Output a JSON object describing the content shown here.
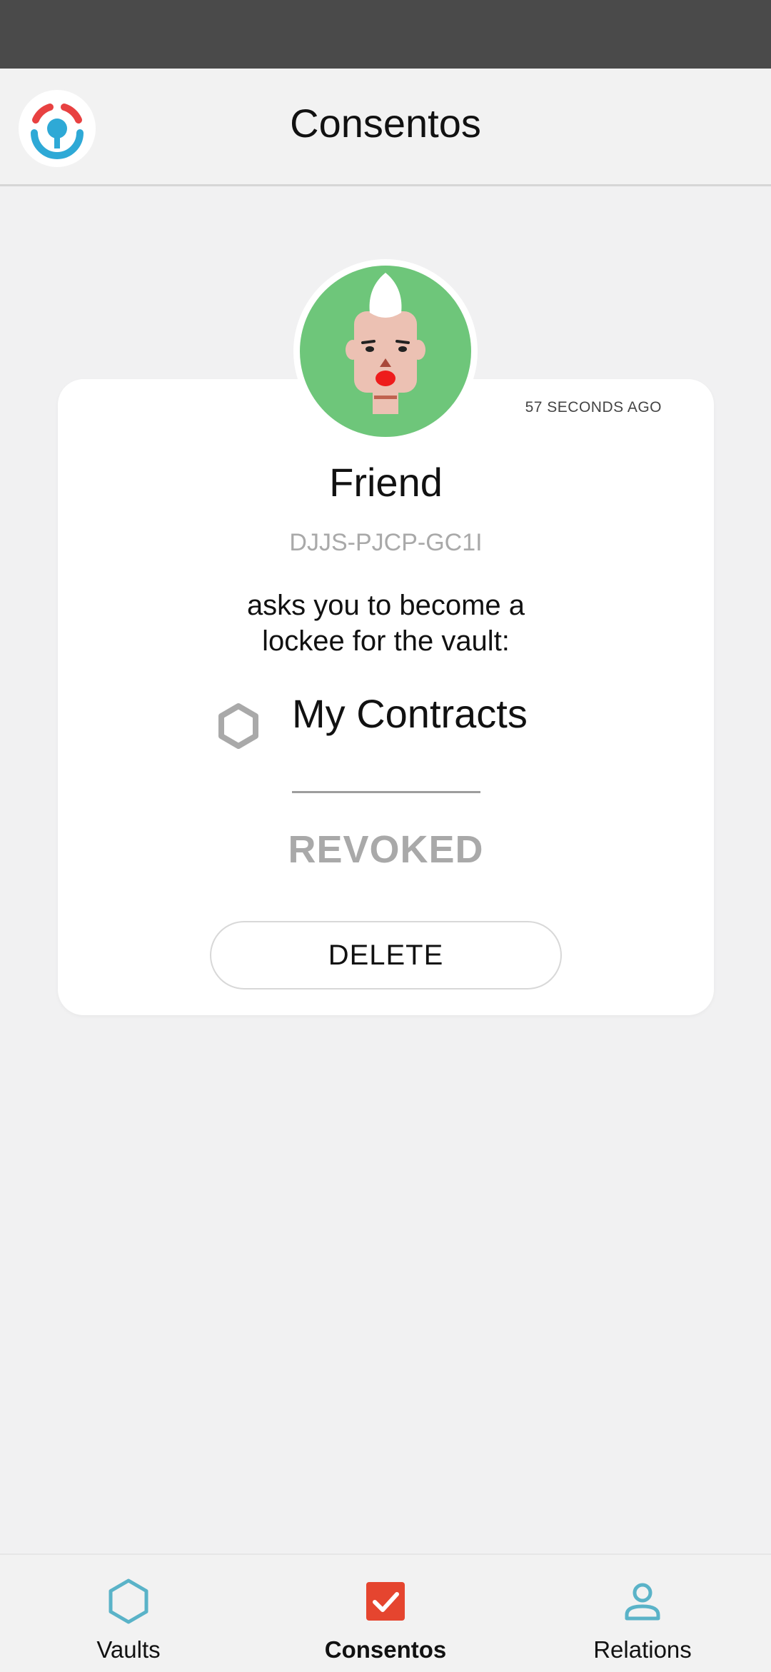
{
  "app_bar": {
    "title": "Consentos"
  },
  "card": {
    "timestamp": "57 SECONDS AGO",
    "friend_name": "Friend",
    "friend_code": "DJJS-PJCP-GC1I",
    "request_text": "asks you to become a\nlockee for the vault:",
    "vault_name": "My Contracts",
    "status": "REVOKED",
    "delete_label": "DELETE"
  },
  "bottom_nav": {
    "items": [
      {
        "label": "Vaults",
        "icon": "hexagon-icon",
        "active": false
      },
      {
        "label": "Consentos",
        "icon": "checkbox-icon",
        "active": true
      },
      {
        "label": "Relations",
        "icon": "person-icon",
        "active": false
      }
    ]
  },
  "colors": {
    "accent_blue": "#5ab3c8",
    "accent_red": "#e5452f",
    "logo_red": "#e84141",
    "logo_blue": "#2ea9d6",
    "avatar_green": "#6ec67a",
    "muted_gray": "#a9a9a9"
  }
}
